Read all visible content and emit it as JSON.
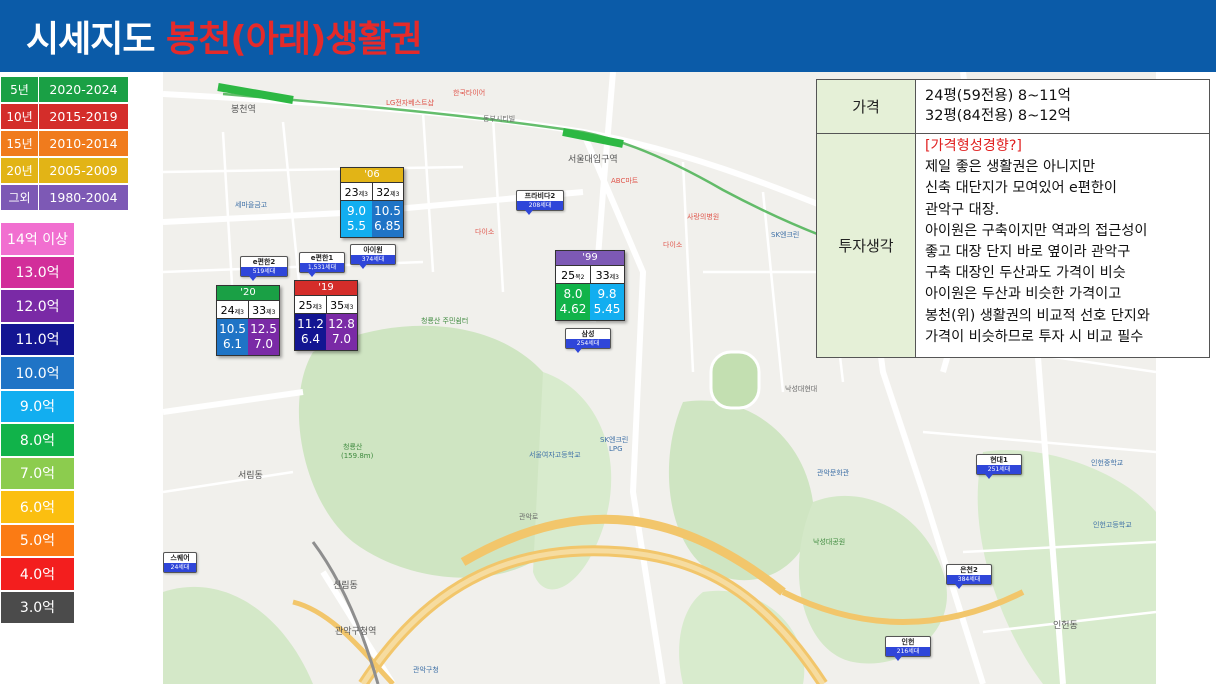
{
  "title": {
    "part1": "시세지도",
    "part2": "봉천(아래)생활권"
  },
  "year_legend": [
    {
      "label": "5년",
      "range": "2020-2024",
      "color": "#1aa045"
    },
    {
      "label": "10년",
      "range": "2015-2019",
      "color": "#d42d2a"
    },
    {
      "label": "15년",
      "range": "2010-2014",
      "color": "#f07b1d"
    },
    {
      "label": "20년",
      "range": "2005-2009",
      "color": "#e2b416"
    },
    {
      "label": "그외",
      "range": "1980-2004",
      "color": "#7d59b5"
    }
  ],
  "price_legend": [
    {
      "label": "14억 이상",
      "color": "#f16fd0"
    },
    {
      "label": "13.0억",
      "color": "#d22e9a"
    },
    {
      "label": "12.0억",
      "color": "#7a2aa6"
    },
    {
      "label": "11.0억",
      "color": "#131592"
    },
    {
      "label": "10.0억",
      "color": "#1f74c6"
    },
    {
      "label": "9.0억",
      "color": "#12aef0"
    },
    {
      "label": "8.0억",
      "color": "#11b34a"
    },
    {
      "label": "7.0억",
      "color": "#8ccc4e"
    },
    {
      "label": "6.0억",
      "color": "#fbbf10"
    },
    {
      "label": "5.0억",
      "color": "#fb7b14"
    },
    {
      "label": "4.0억",
      "color": "#f31e1e"
    },
    {
      "label": "3.0억",
      "color": "#4b4b4b"
    }
  ],
  "cards": [
    {
      "year": "'06",
      "year_color": "#e2b416",
      "sizes": [
        {
          "n": "23",
          "u": "제3"
        },
        {
          "n": "32",
          "u": "제3"
        }
      ],
      "prices": [
        {
          "lines": [
            "9.0",
            "5.5"
          ],
          "color": "#12aef0"
        },
        {
          "lines": [
            "10.5",
            "6.85"
          ],
          "color": "#1f74c6"
        }
      ]
    },
    {
      "year": "'20",
      "year_color": "#1aa045",
      "sizes": [
        {
          "n": "24",
          "u": "제3"
        },
        {
          "n": "33",
          "u": "제3"
        }
      ],
      "prices": [
        {
          "lines": [
            "10.5",
            "6.1"
          ],
          "color": "#1f74c6"
        },
        {
          "lines": [
            "12.5",
            "7.0"
          ],
          "color": "#7a2aa6"
        }
      ]
    },
    {
      "year": "'19",
      "year_color": "#d42d2a",
      "sizes": [
        {
          "n": "25",
          "u": "제3"
        },
        {
          "n": "35",
          "u": "제3"
        }
      ],
      "prices": [
        {
          "lines": [
            "11.2",
            "6.4"
          ],
          "color": "#131592"
        },
        {
          "lines": [
            "12.8",
            "7.0"
          ],
          "color": "#7a2aa6"
        }
      ]
    },
    {
      "year": "'99",
      "year_color": "#7d59b5",
      "sizes": [
        {
          "n": "25",
          "u": "복2"
        },
        {
          "n": "33",
          "u": "제3"
        }
      ],
      "prices": [
        {
          "lines": [
            "8.0",
            "4.62"
          ],
          "color": "#11b34a"
        },
        {
          "lines": [
            "9.8",
            "5.45"
          ],
          "color": "#12aef0"
        }
      ]
    }
  ],
  "markers": [
    {
      "name": "프라비다2",
      "units": "208세대"
    },
    {
      "name": "e편한1",
      "units": "1,531세대"
    },
    {
      "name": "아이원",
      "units": "374세대"
    },
    {
      "name": "e편한2",
      "units": "519세대"
    },
    {
      "name": "삼성",
      "units": "254세대"
    },
    {
      "name": "현대1",
      "units": "251세대"
    },
    {
      "name": "은천2",
      "units": "384세대"
    },
    {
      "name": "인헌",
      "units": "216세대"
    },
    {
      "name": "스퀘어",
      "units": "24세대"
    }
  ],
  "map_labels": {
    "bongcheon_stn": "봉천역",
    "seouldae_stn": "서울대입구역",
    "gwanak_stn": "관악구청역",
    "seorim": "서림동",
    "inheon": "인헌동",
    "nakseong": "낙성대공원",
    "cheongryong": "청룡산",
    "cheongryong_h": "(159.8m)",
    "gwanak_office": "관악구청",
    "abc": "ABC마트",
    "daiso1": "다이소",
    "daiso2": "다이소",
    "hankuk": "한국타이어",
    "lg": "LG전자베스트샵",
    "sk": "SK엔크린",
    "sk_lpg": "LPG",
    "sk_right": "SK엔크린",
    "sungsil": "낙성대현대",
    "cheongryong_park": "청룡산 주민쉼터",
    "gwanak_hall": "관악문화관",
    "inheon_school": "인헌고등학교",
    "inheon_middle": "인헌중학교",
    "seoul_hs": "서울여자고등학교",
    "mj": "세마을금고",
    "gwanakro": "관악로",
    "sk_hub": "사랑의병원",
    "sillim": "신림동",
    "dm": "동부시티빌"
  },
  "info": {
    "price_label": "가격",
    "price_lines": [
      "24평(59전용) 8~11억",
      "32평(84전용) 8~12억"
    ],
    "invest_label": "투자생각",
    "invest_heading": "[가격형성경향?]",
    "invest_lines": [
      "제일 좋은 생활권은 아니지만",
      "신축 대단지가 모여있어 e편한이",
      "관악구 대장.",
      "아이원은 구축이지만 역과의 접근성이",
      "좋고 대장 단지 바로 옆이라 관악구",
      "구축 대장인 두산과도 가격이 비슷",
      "아이원은 두산과 비슷한 가격이고",
      "봉천(위) 생활권의 비교적 선호 단지와",
      "가격이 비슷하므로 투자 시 비교 필수"
    ]
  }
}
